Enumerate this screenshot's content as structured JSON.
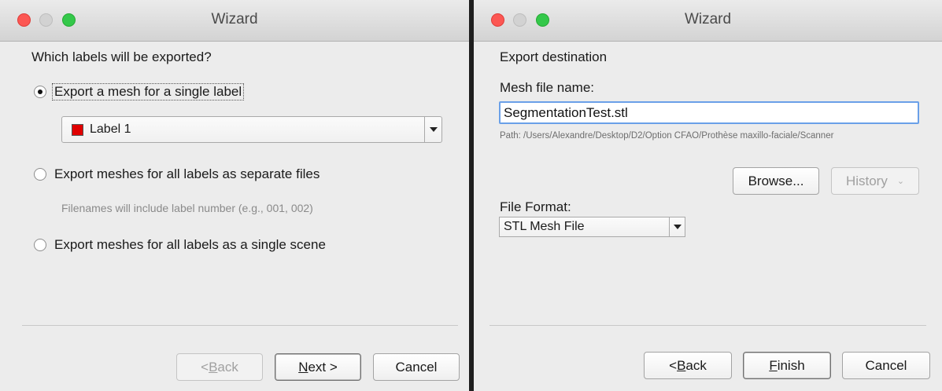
{
  "window1": {
    "title": "Wizard",
    "heading": "Which labels will be exported?",
    "options": [
      {
        "label": "Export a mesh for a single label",
        "selected": true
      },
      {
        "label": "Export meshes for all labels as separate files",
        "selected": false
      },
      {
        "label": "Export meshes for all labels as a single scene",
        "selected": false
      }
    ],
    "label_combo": {
      "value": "Label 1",
      "swatch_color": "#e00000"
    },
    "separate_files_hint": "Filenames will include label number (e.g., 001, 002)",
    "buttons": {
      "back": {
        "prefix": "< ",
        "mnemonic": "B",
        "rest": "ack"
      },
      "next": {
        "mnemonic": "N",
        "rest": "ext >"
      },
      "cancel": "Cancel"
    }
  },
  "window2": {
    "title": "Wizard",
    "heading": "Export destination",
    "mesh_file_label": "Mesh file name:",
    "mesh_file_value": "SegmentationTest.stl",
    "path_text": "Path: /Users/Alexandre/Desktop/D2/Option CFAO/Prothèse maxillo-faciale/Scanner",
    "browse_label": "Browse...",
    "history_label": "History",
    "file_format_label": "File Format:",
    "file_format_value": "STL Mesh File",
    "buttons": {
      "back": {
        "prefix": "< ",
        "mnemonic": "B",
        "rest": "ack"
      },
      "finish": {
        "mnemonic": "F",
        "rest": "inish"
      },
      "cancel": "Cancel"
    }
  },
  "colors": {
    "close_light": "#fc5753",
    "minimize_light": "#d2d2d2",
    "zoom_light": "#34c84a",
    "focus_border": "#6aa0e8"
  }
}
